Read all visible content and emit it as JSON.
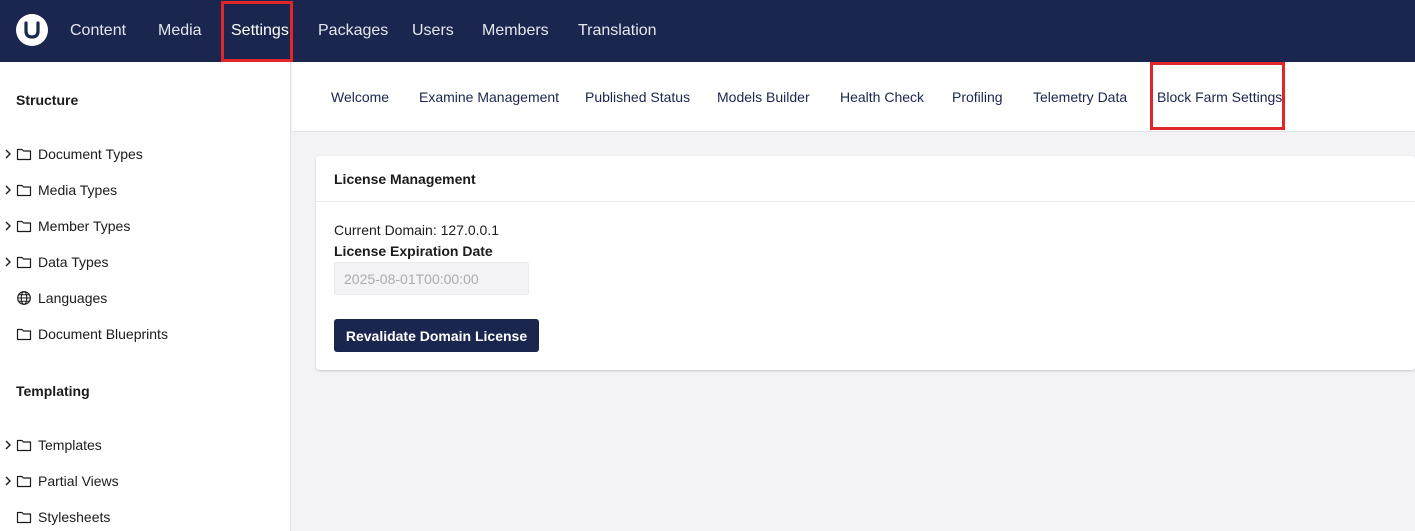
{
  "header": {
    "logo_icon": "umbraco-logo-icon",
    "nav": [
      {
        "label": "Content"
      },
      {
        "label": "Media"
      },
      {
        "label": "Settings",
        "active": true
      },
      {
        "label": "Packages"
      },
      {
        "label": "Users"
      },
      {
        "label": "Members"
      },
      {
        "label": "Translation"
      }
    ]
  },
  "sidebar": {
    "structure_title": "Structure",
    "structure_items": [
      {
        "label": "Document Types",
        "icon": "folder-icon",
        "expandable": true
      },
      {
        "label": "Media Types",
        "icon": "folder-icon",
        "expandable": true
      },
      {
        "label": "Member Types",
        "icon": "folder-icon",
        "expandable": true
      },
      {
        "label": "Data Types",
        "icon": "folder-icon",
        "expandable": true
      },
      {
        "label": "Languages",
        "icon": "globe-icon",
        "expandable": false
      },
      {
        "label": "Document Blueprints",
        "icon": "folder-icon",
        "expandable": false
      }
    ],
    "templating_title": "Templating",
    "templating_items": [
      {
        "label": "Templates",
        "icon": "folder-icon",
        "expandable": true
      },
      {
        "label": "Partial Views",
        "icon": "folder-icon",
        "expandable": true
      },
      {
        "label": "Stylesheets",
        "icon": "folder-icon",
        "expandable": false
      }
    ]
  },
  "tabs": [
    {
      "label": "Welcome"
    },
    {
      "label": "Examine Management"
    },
    {
      "label": "Published Status"
    },
    {
      "label": "Models Builder"
    },
    {
      "label": "Health Check"
    },
    {
      "label": "Profiling"
    },
    {
      "label": "Telemetry Data"
    },
    {
      "label": "Block Farm Settings",
      "active": true
    }
  ],
  "panel": {
    "title": "License Management",
    "current_domain": "Current Domain: 127.0.0.1",
    "expiry_label": "License Expiration Date",
    "expiry_value": "2025-08-01T00:00:00",
    "button_label": "Revalidate Domain License"
  },
  "colors": {
    "header_bg": "#1b264f",
    "highlight": "#e0262b",
    "button_bg": "#1b264f"
  }
}
